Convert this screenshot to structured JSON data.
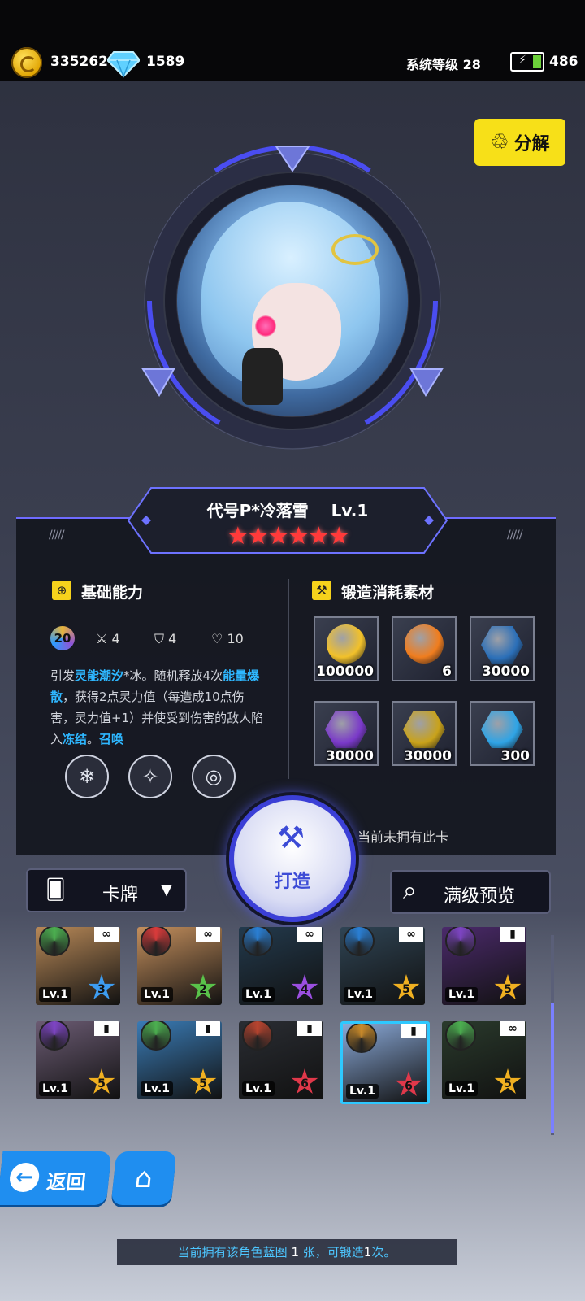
{
  "currency": {
    "gold": "335262",
    "gems": "1589",
    "system_level": "系统等级 28",
    "stamina": "486"
  },
  "dismantle_label": "分解",
  "character": {
    "name": "代号P*冷落雪",
    "level": "Lv.1",
    "stars": "★★★★★★",
    "star_count": 6
  },
  "basic": {
    "title": "基础能力",
    "level_badge": "20",
    "attack": "4",
    "defense": "4",
    "hp": "10",
    "desc_parts": [
      "引发",
      "灵能潮汐",
      "*冰。随机释放4次",
      "能量爆散",
      "，获得2点灵力值（每造成10点伤害，灵力值+1）并使受到伤害的敌人陷入",
      "冻结",
      "。",
      "召唤"
    ]
  },
  "skill_icons": [
    "snowflake-shield-icon",
    "sparkle-circle-icon",
    "swirl-icon"
  ],
  "materials": {
    "title": "锻造消耗素材",
    "items": [
      {
        "name": "gold-coin",
        "qty": "100000",
        "color": "#f2c12a"
      },
      {
        "name": "fire-orb",
        "qty": "6",
        "color": "#f07d1e"
      },
      {
        "name": "ice-crystal",
        "qty": "30000",
        "color": "#2b6fb8"
      },
      {
        "name": "purple-rune",
        "qty": "30000",
        "color": "#7a39c9"
      },
      {
        "name": "gold-gear",
        "qty": "30000",
        "color": "#c9a21a"
      },
      {
        "name": "blue-cube",
        "qty": "300",
        "color": "#2fa4e6"
      }
    ]
  },
  "forge_label": "打造",
  "not_owned": "当前未拥有此卡",
  "card_filter": "卡牌",
  "preview_label": "满级预览",
  "cards": [
    {
      "lv": "Lv.1",
      "star": "3",
      "tag": "∞",
      "bg": "#b88958",
      "elem": "#4caf50",
      "starColor": "#3d9cf0"
    },
    {
      "lv": "Lv.1",
      "star": "2",
      "tag": "∞",
      "bg": "#c48f5d",
      "elem": "#d93b3b",
      "starColor": "#59c24a"
    },
    {
      "lv": "Lv.1",
      "star": "4",
      "tag": "∞",
      "bg": "#233a4d",
      "elem": "#2a7fd4",
      "starColor": "#9b4fe0"
    },
    {
      "lv": "Lv.1",
      "star": "5",
      "tag": "∞",
      "bg": "#2f4454",
      "elem": "#2a7fd4",
      "starColor": "#f0b021"
    },
    {
      "lv": "Lv.1",
      "star": "5",
      "tag": "▮",
      "bg": "#4b2a6b",
      "elem": "#7e45c4",
      "starColor": "#f0b021"
    },
    {
      "lv": "Lv.1",
      "star": "5",
      "tag": "▮",
      "bg": "#6b5b73",
      "elem": "#7e45c4",
      "starColor": "#f0b021"
    },
    {
      "lv": "Lv.1",
      "star": "5",
      "tag": "▮",
      "bg": "#3a7bb5",
      "elem": "#4caf50",
      "starColor": "#f0b021"
    },
    {
      "lv": "Lv.1",
      "star": "6",
      "tag": "▮",
      "bg": "#2a2d33",
      "elem": "#b8442f",
      "starColor": "#e0384a"
    },
    {
      "lv": "Lv.1",
      "star": "6",
      "tag": "▮",
      "bg": "#8aa9d8",
      "elem": "#c98a2a",
      "starColor": "#e0384a"
    },
    {
      "lv": "Lv.1",
      "star": "5",
      "tag": "∞",
      "bg": "#2a3a2c",
      "elem": "#4caf50",
      "starColor": "#f0b021"
    }
  ],
  "nav": {
    "back": "返回",
    "home": "home"
  },
  "bottom_msg": {
    "p1": "当前拥有该角色蓝图 ",
    "n1": "1",
    "p2": " 张，可锻造",
    "n2": "1",
    "p3": "次。"
  }
}
